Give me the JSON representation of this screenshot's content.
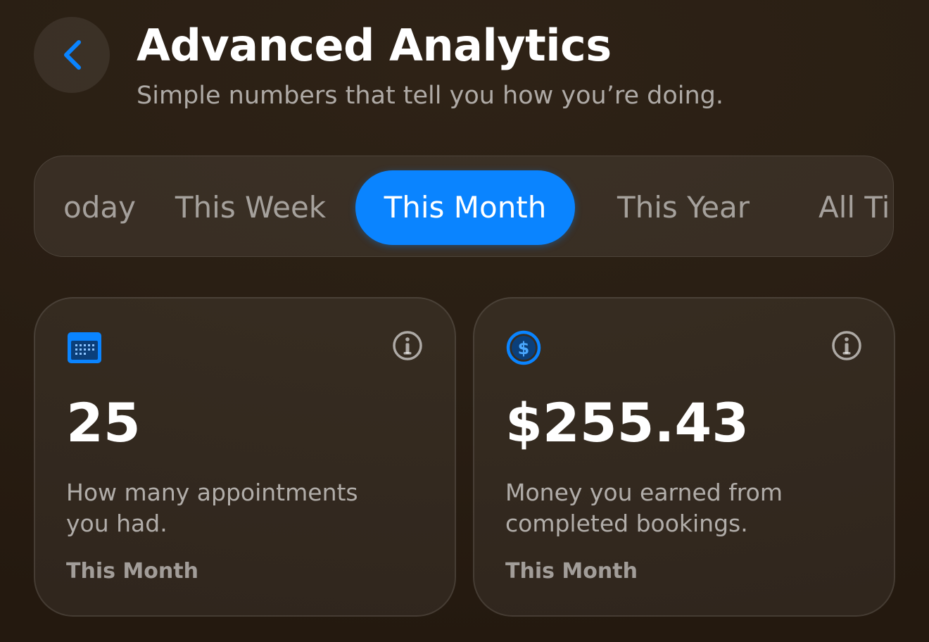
{
  "header": {
    "back_icon": "chevron-left-icon",
    "title": "Advanced Analytics",
    "subtitle": "Simple numbers that tell you how you’re doing."
  },
  "periods": {
    "options": [
      "oday",
      "This Week",
      "This Month",
      "This Year",
      "All Ti"
    ],
    "selected": "This Month"
  },
  "cards": [
    {
      "icon": "calendar-icon",
      "value": "25",
      "description": "How many appointments you had.",
      "period": "This Month"
    },
    {
      "icon": "dollar-circle-icon",
      "value": "$255.43",
      "description": "Money you earned from completed bookings.",
      "period": "This Month"
    }
  ],
  "colors": {
    "accent": "#0a84ff",
    "background": "#2a1f14"
  }
}
